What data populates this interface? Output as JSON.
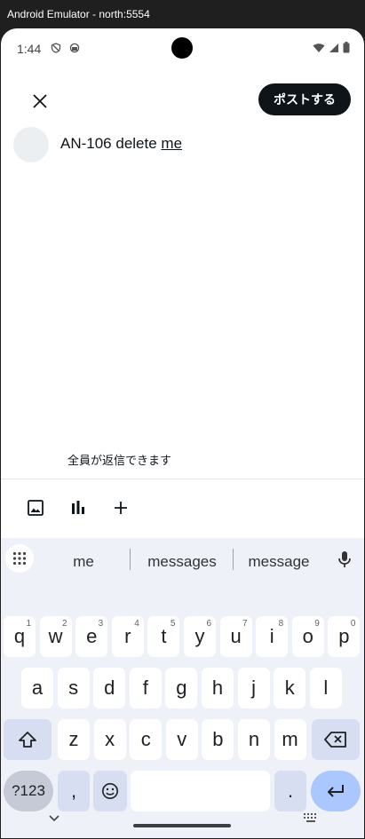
{
  "window": {
    "title": "Android Emulator - north:5554"
  },
  "status_bar": {
    "time": "1:44"
  },
  "header": {
    "post_button_label": "ポストする"
  },
  "compose": {
    "text_before": "AN-106 delete ",
    "text_underlined": "me"
  },
  "reply_setting": {
    "label": "全員が返信できます"
  },
  "toolbar": {
    "icons": [
      "image-icon",
      "poll-icon",
      "plus-icon"
    ]
  },
  "keyboard": {
    "suggestions": [
      "me",
      "messages",
      "message"
    ],
    "rows": [
      [
        {
          "k": "q",
          "h": "1"
        },
        {
          "k": "w",
          "h": "2"
        },
        {
          "k": "e",
          "h": "3"
        },
        {
          "k": "r",
          "h": "4"
        },
        {
          "k": "t",
          "h": "5"
        },
        {
          "k": "y",
          "h": "6"
        },
        {
          "k": "u",
          "h": "7"
        },
        {
          "k": "i",
          "h": "8"
        },
        {
          "k": "o",
          "h": "9"
        },
        {
          "k": "p",
          "h": "0"
        }
      ],
      [
        {
          "k": "a"
        },
        {
          "k": "s"
        },
        {
          "k": "d"
        },
        {
          "k": "f"
        },
        {
          "k": "g"
        },
        {
          "k": "h"
        },
        {
          "k": "j"
        },
        {
          "k": "k"
        },
        {
          "k": "l"
        }
      ],
      [
        {
          "k": "z"
        },
        {
          "k": "x"
        },
        {
          "k": "c"
        },
        {
          "k": "v"
        },
        {
          "k": "b"
        },
        {
          "k": "n"
        },
        {
          "k": "m"
        }
      ]
    ],
    "symbols_label": "?123",
    "comma_label": ",",
    "period_label": "."
  }
}
